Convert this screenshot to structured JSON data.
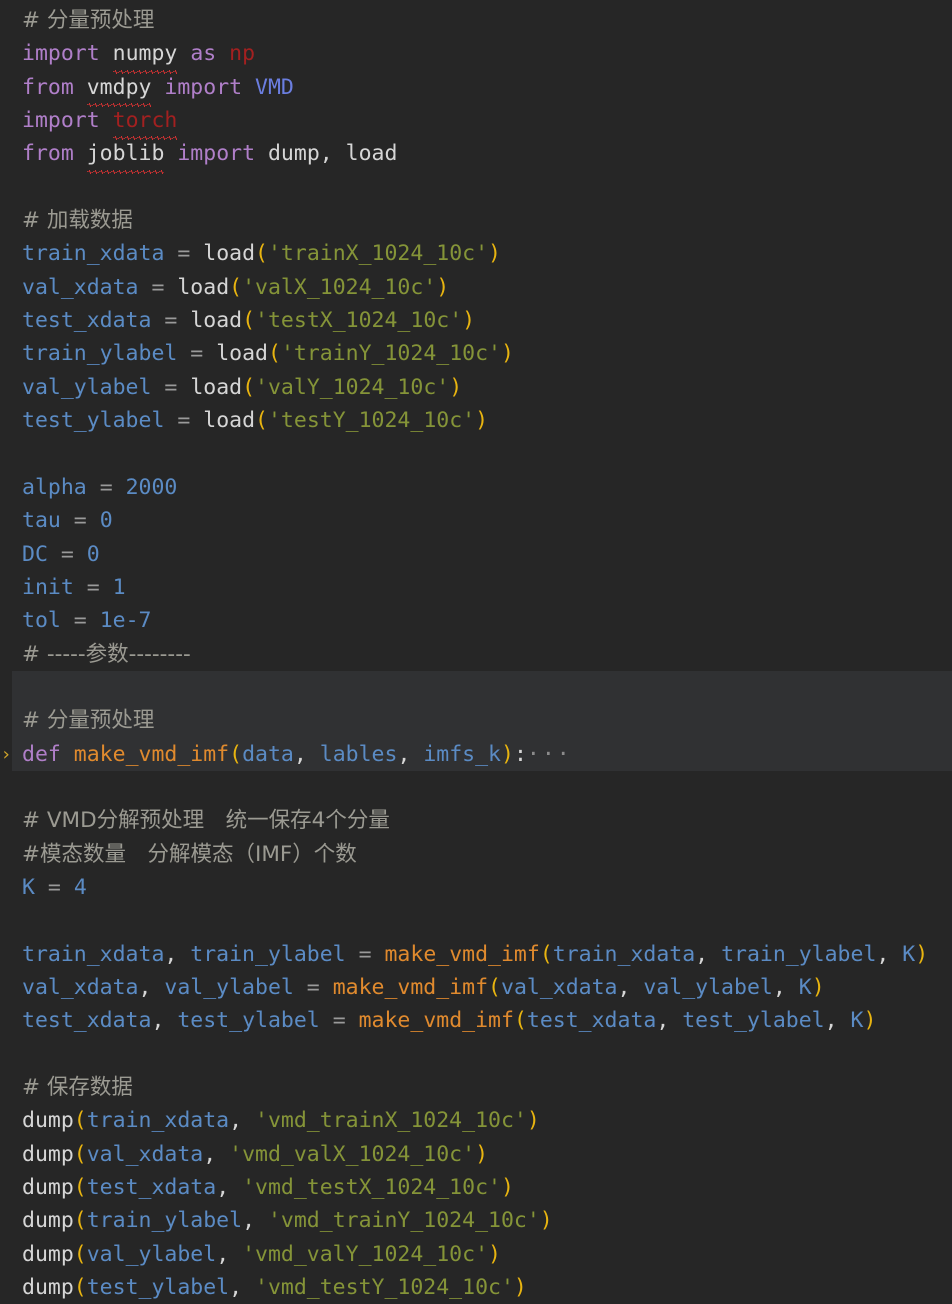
{
  "editor": {
    "language": "python",
    "background_color": "#262626",
    "highlight_band_color": "#303133",
    "fold_chevron": "›",
    "fold_ellipsis": "···",
    "colors": {
      "comment": "#9b9a92",
      "keyword": "#b07fc9",
      "plain_text": "#d6d6d6",
      "variable": "#5b8bc4",
      "number": "#5b8bc4",
      "string": "#859438",
      "paren": "#e8b410",
      "function": "#e08a2e",
      "class": "#6b7ee0",
      "error": "#a32020",
      "operator": "#9a9a9a",
      "fold_marker": "#8b8b8b",
      "gutter_chevron": "#d0a429",
      "squiggle": "#d33333"
    }
  },
  "lines": [
    {
      "tokens": [
        {
          "t": "# 分量预处理",
          "c": "comment",
          "cjk": true
        }
      ]
    },
    {
      "tokens": [
        {
          "t": "import",
          "c": "kw"
        },
        {
          "t": " ",
          "c": "plain"
        },
        {
          "t": "numpy",
          "c": "plain",
          "squiggle": true
        },
        {
          "t": " ",
          "c": "plain"
        },
        {
          "t": "as",
          "c": "kw"
        },
        {
          "t": " ",
          "c": "plain"
        },
        {
          "t": "np",
          "c": "err"
        }
      ]
    },
    {
      "tokens": [
        {
          "t": "from",
          "c": "kw"
        },
        {
          "t": " ",
          "c": "plain"
        },
        {
          "t": "vmdpy",
          "c": "plain",
          "squiggle": true
        },
        {
          "t": " ",
          "c": "plain"
        },
        {
          "t": "import",
          "c": "kw"
        },
        {
          "t": " ",
          "c": "plain"
        },
        {
          "t": "VMD",
          "c": "cls"
        }
      ]
    },
    {
      "tokens": [
        {
          "t": "import",
          "c": "kw"
        },
        {
          "t": " ",
          "c": "plain"
        },
        {
          "t": "torch",
          "c": "err",
          "squiggle": true
        }
      ]
    },
    {
      "tokens": [
        {
          "t": "from",
          "c": "kw"
        },
        {
          "t": " ",
          "c": "plain"
        },
        {
          "t": "joblib",
          "c": "plain",
          "squiggle": true
        },
        {
          "t": " ",
          "c": "plain"
        },
        {
          "t": "import",
          "c": "kw"
        },
        {
          "t": " ",
          "c": "plain"
        },
        {
          "t": "dump, load",
          "c": "plain"
        }
      ]
    },
    {
      "tokens": []
    },
    {
      "tokens": [
        {
          "t": "# 加载数据",
          "c": "comment",
          "cjk": true
        }
      ]
    },
    {
      "tokens": [
        {
          "t": "train_xdata",
          "c": "var"
        },
        {
          "t": " ",
          "c": "plain"
        },
        {
          "t": "=",
          "c": "op"
        },
        {
          "t": " ",
          "c": "plain"
        },
        {
          "t": "load",
          "c": "plain"
        },
        {
          "t": "(",
          "c": "paren"
        },
        {
          "t": "'trainX_1024_10c'",
          "c": "str"
        },
        {
          "t": ")",
          "c": "paren"
        }
      ]
    },
    {
      "tokens": [
        {
          "t": "val_xdata",
          "c": "var"
        },
        {
          "t": " ",
          "c": "plain"
        },
        {
          "t": "=",
          "c": "op"
        },
        {
          "t": " ",
          "c": "plain"
        },
        {
          "t": "load",
          "c": "plain"
        },
        {
          "t": "(",
          "c": "paren"
        },
        {
          "t": "'valX_1024_10c'",
          "c": "str"
        },
        {
          "t": ")",
          "c": "paren"
        }
      ]
    },
    {
      "tokens": [
        {
          "t": "test_xdata",
          "c": "var"
        },
        {
          "t": " ",
          "c": "plain"
        },
        {
          "t": "=",
          "c": "op"
        },
        {
          "t": " ",
          "c": "plain"
        },
        {
          "t": "load",
          "c": "plain"
        },
        {
          "t": "(",
          "c": "paren"
        },
        {
          "t": "'testX_1024_10c'",
          "c": "str"
        },
        {
          "t": ")",
          "c": "paren"
        }
      ]
    },
    {
      "tokens": [
        {
          "t": "train_ylabel",
          "c": "var"
        },
        {
          "t": " ",
          "c": "plain"
        },
        {
          "t": "=",
          "c": "op"
        },
        {
          "t": " ",
          "c": "plain"
        },
        {
          "t": "load",
          "c": "plain"
        },
        {
          "t": "(",
          "c": "paren"
        },
        {
          "t": "'trainY_1024_10c'",
          "c": "str"
        },
        {
          "t": ")",
          "c": "paren"
        }
      ]
    },
    {
      "tokens": [
        {
          "t": "val_ylabel",
          "c": "var"
        },
        {
          "t": " ",
          "c": "plain"
        },
        {
          "t": "=",
          "c": "op"
        },
        {
          "t": " ",
          "c": "plain"
        },
        {
          "t": "load",
          "c": "plain"
        },
        {
          "t": "(",
          "c": "paren"
        },
        {
          "t": "'valY_1024_10c'",
          "c": "str"
        },
        {
          "t": ")",
          "c": "paren"
        }
      ]
    },
    {
      "tokens": [
        {
          "t": "test_ylabel",
          "c": "var"
        },
        {
          "t": " ",
          "c": "plain"
        },
        {
          "t": "=",
          "c": "op"
        },
        {
          "t": " ",
          "c": "plain"
        },
        {
          "t": "load",
          "c": "plain"
        },
        {
          "t": "(",
          "c": "paren"
        },
        {
          "t": "'testY_1024_10c'",
          "c": "str"
        },
        {
          "t": ")",
          "c": "paren"
        }
      ]
    },
    {
      "tokens": []
    },
    {
      "tokens": [
        {
          "t": "alpha",
          "c": "var"
        },
        {
          "t": " ",
          "c": "plain"
        },
        {
          "t": "=",
          "c": "op"
        },
        {
          "t": " ",
          "c": "plain"
        },
        {
          "t": "2000",
          "c": "num"
        }
      ]
    },
    {
      "tokens": [
        {
          "t": "tau",
          "c": "var"
        },
        {
          "t": " ",
          "c": "plain"
        },
        {
          "t": "=",
          "c": "op"
        },
        {
          "t": " ",
          "c": "plain"
        },
        {
          "t": "0",
          "c": "num"
        }
      ]
    },
    {
      "tokens": [
        {
          "t": "DC",
          "c": "var"
        },
        {
          "t": " ",
          "c": "plain"
        },
        {
          "t": "=",
          "c": "op"
        },
        {
          "t": " ",
          "c": "plain"
        },
        {
          "t": "0",
          "c": "num"
        }
      ]
    },
    {
      "tokens": [
        {
          "t": "init",
          "c": "var"
        },
        {
          "t": " ",
          "c": "plain"
        },
        {
          "t": "=",
          "c": "op"
        },
        {
          "t": " ",
          "c": "plain"
        },
        {
          "t": "1",
          "c": "num"
        }
      ]
    },
    {
      "tokens": [
        {
          "t": "tol",
          "c": "var"
        },
        {
          "t": " ",
          "c": "plain"
        },
        {
          "t": "=",
          "c": "op"
        },
        {
          "t": " ",
          "c": "plain"
        },
        {
          "t": "1e-7",
          "c": "num"
        }
      ]
    },
    {
      "tokens": [
        {
          "t": "# -----参数--------",
          "c": "comment",
          "cjk": true
        }
      ]
    },
    {
      "tokens": [],
      "highlight": true
    },
    {
      "tokens": [
        {
          "t": "# 分量预处理",
          "c": "comment",
          "cjk": true
        }
      ],
      "highlight": true
    },
    {
      "tokens": [
        {
          "t": "def",
          "c": "kw"
        },
        {
          "t": " ",
          "c": "plain"
        },
        {
          "t": "make_vmd_imf",
          "c": "func"
        },
        {
          "t": "(",
          "c": "paren"
        },
        {
          "t": "data",
          "c": "var"
        },
        {
          "t": ", ",
          "c": "punct"
        },
        {
          "t": "lables",
          "c": "var"
        },
        {
          "t": ", ",
          "c": "punct"
        },
        {
          "t": "imfs_k",
          "c": "var"
        },
        {
          "t": ")",
          "c": "paren"
        },
        {
          "t": ":",
          "c": "punct"
        },
        {
          "t": "···",
          "c": "fold"
        }
      ],
      "highlight": true,
      "chevron": true
    },
    {
      "tokens": []
    },
    {
      "tokens": [
        {
          "t": "# VMD分解预处理　统一保存4个分量",
          "c": "comment",
          "cjk": true
        }
      ]
    },
    {
      "tokens": [
        {
          "t": "#模态数量　分解模态（IMF）个数",
          "c": "comment",
          "cjk": true
        }
      ]
    },
    {
      "tokens": [
        {
          "t": "K",
          "c": "var"
        },
        {
          "t": " ",
          "c": "plain"
        },
        {
          "t": "=",
          "c": "op"
        },
        {
          "t": " ",
          "c": "plain"
        },
        {
          "t": "4",
          "c": "num"
        }
      ]
    },
    {
      "tokens": []
    },
    {
      "tokens": [
        {
          "t": "train_xdata",
          "c": "var"
        },
        {
          "t": ", ",
          "c": "punct"
        },
        {
          "t": "train_ylabel",
          "c": "var"
        },
        {
          "t": " ",
          "c": "plain"
        },
        {
          "t": "=",
          "c": "op"
        },
        {
          "t": " ",
          "c": "plain"
        },
        {
          "t": "make_vmd_imf",
          "c": "func"
        },
        {
          "t": "(",
          "c": "paren"
        },
        {
          "t": "train_xdata",
          "c": "var"
        },
        {
          "t": ", ",
          "c": "punct"
        },
        {
          "t": "train_ylabel",
          "c": "var"
        },
        {
          "t": ", ",
          "c": "punct"
        },
        {
          "t": "K",
          "c": "var"
        },
        {
          "t": ")",
          "c": "paren"
        }
      ]
    },
    {
      "tokens": [
        {
          "t": "val_xdata",
          "c": "var"
        },
        {
          "t": ", ",
          "c": "punct"
        },
        {
          "t": "val_ylabel",
          "c": "var"
        },
        {
          "t": " ",
          "c": "plain"
        },
        {
          "t": "=",
          "c": "op"
        },
        {
          "t": " ",
          "c": "plain"
        },
        {
          "t": "make_vmd_imf",
          "c": "func"
        },
        {
          "t": "(",
          "c": "paren"
        },
        {
          "t": "val_xdata",
          "c": "var"
        },
        {
          "t": ", ",
          "c": "punct"
        },
        {
          "t": "val_ylabel",
          "c": "var"
        },
        {
          "t": ", ",
          "c": "punct"
        },
        {
          "t": "K",
          "c": "var"
        },
        {
          "t": ")",
          "c": "paren"
        }
      ]
    },
    {
      "tokens": [
        {
          "t": "test_xdata",
          "c": "var"
        },
        {
          "t": ", ",
          "c": "punct"
        },
        {
          "t": "test_ylabel",
          "c": "var"
        },
        {
          "t": " ",
          "c": "plain"
        },
        {
          "t": "=",
          "c": "op"
        },
        {
          "t": " ",
          "c": "plain"
        },
        {
          "t": "make_vmd_imf",
          "c": "func"
        },
        {
          "t": "(",
          "c": "paren"
        },
        {
          "t": "test_xdata",
          "c": "var"
        },
        {
          "t": ", ",
          "c": "punct"
        },
        {
          "t": "test_ylabel",
          "c": "var"
        },
        {
          "t": ", ",
          "c": "punct"
        },
        {
          "t": "K",
          "c": "var"
        },
        {
          "t": ")",
          "c": "paren"
        }
      ]
    },
    {
      "tokens": []
    },
    {
      "tokens": [
        {
          "t": "# 保存数据",
          "c": "comment",
          "cjk": true
        }
      ]
    },
    {
      "tokens": [
        {
          "t": "dump",
          "c": "plain"
        },
        {
          "t": "(",
          "c": "paren"
        },
        {
          "t": "train_xdata",
          "c": "var"
        },
        {
          "t": ", ",
          "c": "punct"
        },
        {
          "t": "'vmd_trainX_1024_10c'",
          "c": "str"
        },
        {
          "t": ")",
          "c": "paren"
        }
      ]
    },
    {
      "tokens": [
        {
          "t": "dump",
          "c": "plain"
        },
        {
          "t": "(",
          "c": "paren"
        },
        {
          "t": "val_xdata",
          "c": "var"
        },
        {
          "t": ", ",
          "c": "punct"
        },
        {
          "t": "'vmd_valX_1024_10c'",
          "c": "str"
        },
        {
          "t": ")",
          "c": "paren"
        }
      ]
    },
    {
      "tokens": [
        {
          "t": "dump",
          "c": "plain"
        },
        {
          "t": "(",
          "c": "paren"
        },
        {
          "t": "test_xdata",
          "c": "var"
        },
        {
          "t": ", ",
          "c": "punct"
        },
        {
          "t": "'vmd_testX_1024_10c'",
          "c": "str"
        },
        {
          "t": ")",
          "c": "paren"
        }
      ]
    },
    {
      "tokens": [
        {
          "t": "dump",
          "c": "plain"
        },
        {
          "t": "(",
          "c": "paren"
        },
        {
          "t": "train_ylabel",
          "c": "var"
        },
        {
          "t": ", ",
          "c": "punct"
        },
        {
          "t": "'vmd_trainY_1024_10c'",
          "c": "str"
        },
        {
          "t": ")",
          "c": "paren"
        }
      ]
    },
    {
      "tokens": [
        {
          "t": "dump",
          "c": "plain"
        },
        {
          "t": "(",
          "c": "paren"
        },
        {
          "t": "val_ylabel",
          "c": "var"
        },
        {
          "t": ", ",
          "c": "punct"
        },
        {
          "t": "'vmd_valY_1024_10c'",
          "c": "str"
        },
        {
          "t": ")",
          "c": "paren"
        }
      ]
    },
    {
      "tokens": [
        {
          "t": "dump",
          "c": "plain"
        },
        {
          "t": "(",
          "c": "paren"
        },
        {
          "t": "test_ylabel",
          "c": "var"
        },
        {
          "t": ", ",
          "c": "punct"
        },
        {
          "t": "'vmd_testY_1024_10c'",
          "c": "str"
        },
        {
          "t": ")",
          "c": "paren"
        }
      ]
    }
  ]
}
